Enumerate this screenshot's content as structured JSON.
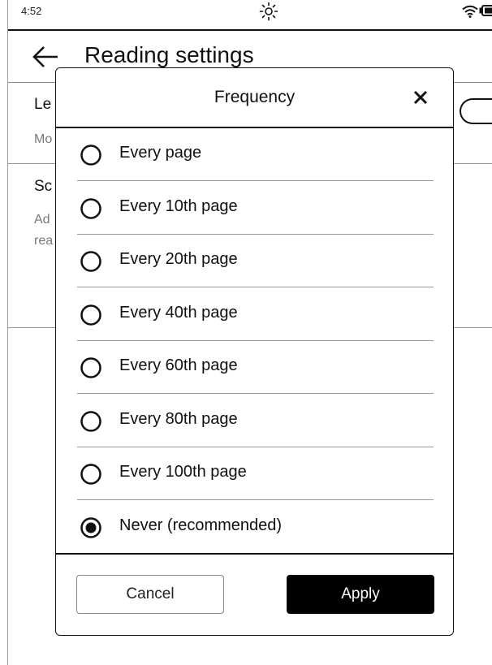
{
  "status_bar": {
    "time": "4:52",
    "icons": [
      "frontlight-sun-icon",
      "wifi-icon",
      "battery-icon"
    ]
  },
  "header": {
    "title": "Reading settings",
    "back_icon": "arrow-left-icon"
  },
  "background": {
    "setting1_title": "Le",
    "setting1_sub": "Mo",
    "setting2_title": "Sc",
    "setting2_sub_line1": "Ad",
    "setting2_sub_line2": "rea"
  },
  "dialog": {
    "title": "Frequency",
    "close_icon": "close-x-icon",
    "options": [
      {
        "label": "Every page",
        "selected": false
      },
      {
        "label": "Every 10th page",
        "selected": false
      },
      {
        "label": "Every 20th page",
        "selected": false
      },
      {
        "label": "Every 40th page",
        "selected": false
      },
      {
        "label": "Every 60th page",
        "selected": false
      },
      {
        "label": "Every 80th page",
        "selected": false
      },
      {
        "label": "Every 100th page",
        "selected": false
      },
      {
        "label": "Never (recommended)",
        "selected": true
      }
    ],
    "cancel_label": "Cancel",
    "apply_label": "Apply"
  },
  "colors": {
    "ink": "#111111",
    "divider": "#999999",
    "primary_button": "#000000",
    "background": "#ffffff"
  }
}
